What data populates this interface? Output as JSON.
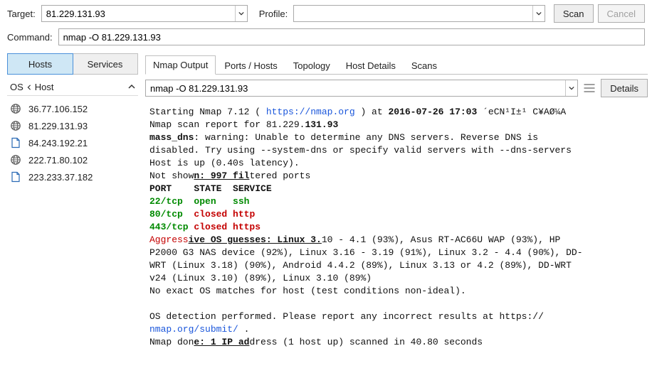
{
  "top": {
    "target_label": "Target:",
    "target_value": "81.229.131.93",
    "profile_label": "Profile:",
    "profile_value": "",
    "scan_label": "Scan",
    "cancel_label": "Cancel"
  },
  "command": {
    "label": "Command:",
    "value": "nmap -O 81.229.131.93"
  },
  "left": {
    "tabs": {
      "hosts": "Hosts",
      "services": "Services"
    },
    "header": {
      "os": "OS",
      "host": "Host"
    },
    "hosts": [
      {
        "icon": "globe",
        "ip": "36.77.106.152"
      },
      {
        "icon": "globe",
        "ip": "81.229.131.93"
      },
      {
        "icon": "doc",
        "ip": "84.243.192.21"
      },
      {
        "icon": "globe",
        "ip": "222.71.80.102"
      },
      {
        "icon": "doc",
        "ip": "223.233.37.182"
      }
    ]
  },
  "right": {
    "tabs": {
      "nmap_output": "Nmap Output",
      "ports_hosts": "Ports / Hosts",
      "topology": "Topology",
      "host_details": "Host Details",
      "scans": "Scans"
    },
    "scan_select": "nmap -O 81.229.131.93",
    "details_label": "Details"
  },
  "output": {
    "l1a": "Starting Nmap 7.12 ( ",
    "l1b": "https://nmap.org",
    "l1c": " ) at ",
    "l1d": "2016-07-26 17:03",
    "l1e": " ´eCN¹I±¹ C¥AØ¼A",
    "l2a": "Nmap scan report for 81.229.",
    "l2b": "131.93",
    "l3a": "mass_dns",
    "l3b": ": warning: Unable to determine any DNS servers. Reverse DNS is ",
    "l4": "disabled. Try using --system-dns or specify valid servers with --dns-servers",
    "l5": "Host is up (0.40s latency).",
    "l6a": "Not show",
    "l6b": "n: 997 fil",
    "l6c": "tered ports",
    "l7": "PORT    STATE  SERVICE",
    "l8a": "22/tcp",
    "l8b": "  open",
    "l8c": "   ssh",
    "l9a": "80/tcp",
    "l9b": "  closed",
    "l9c": " http",
    "l10a": "443/tcp",
    "l10b": " closed",
    "l10c": " https",
    "l11a": "Aggress",
    "l11b": "ive OS guesses: Linux 3.",
    "l11c": "10 - 4.1 (93%), Asus RT-AC66U WAP (93%), HP ",
    "l12": "P2000 G3 NAS device (92%), Linux 3.16 - 3.19 (91%), Linux 3.2 - 4.4 (90%), DD-",
    "l13": "WRT (Linux 3.18) (90%), Android 4.4.2 (89%), Linux 3.13 or 4.2 (89%), DD-WRT ",
    "l14": "v24 (Linux 3.10) (89%), Linux 3.10 (89%)",
    "l15": "No exact OS matches for host (test conditions non-ideal).",
    "l17": "OS detection performed. Please report any incorrect results at https://",
    "l18a": "nmap.org/submit/",
    "l18b": " .",
    "l19a": "Nmap don",
    "l19b": "e: 1 IP ad",
    "l19c": "dress (1 host up) scanned in 40.80 seconds"
  }
}
